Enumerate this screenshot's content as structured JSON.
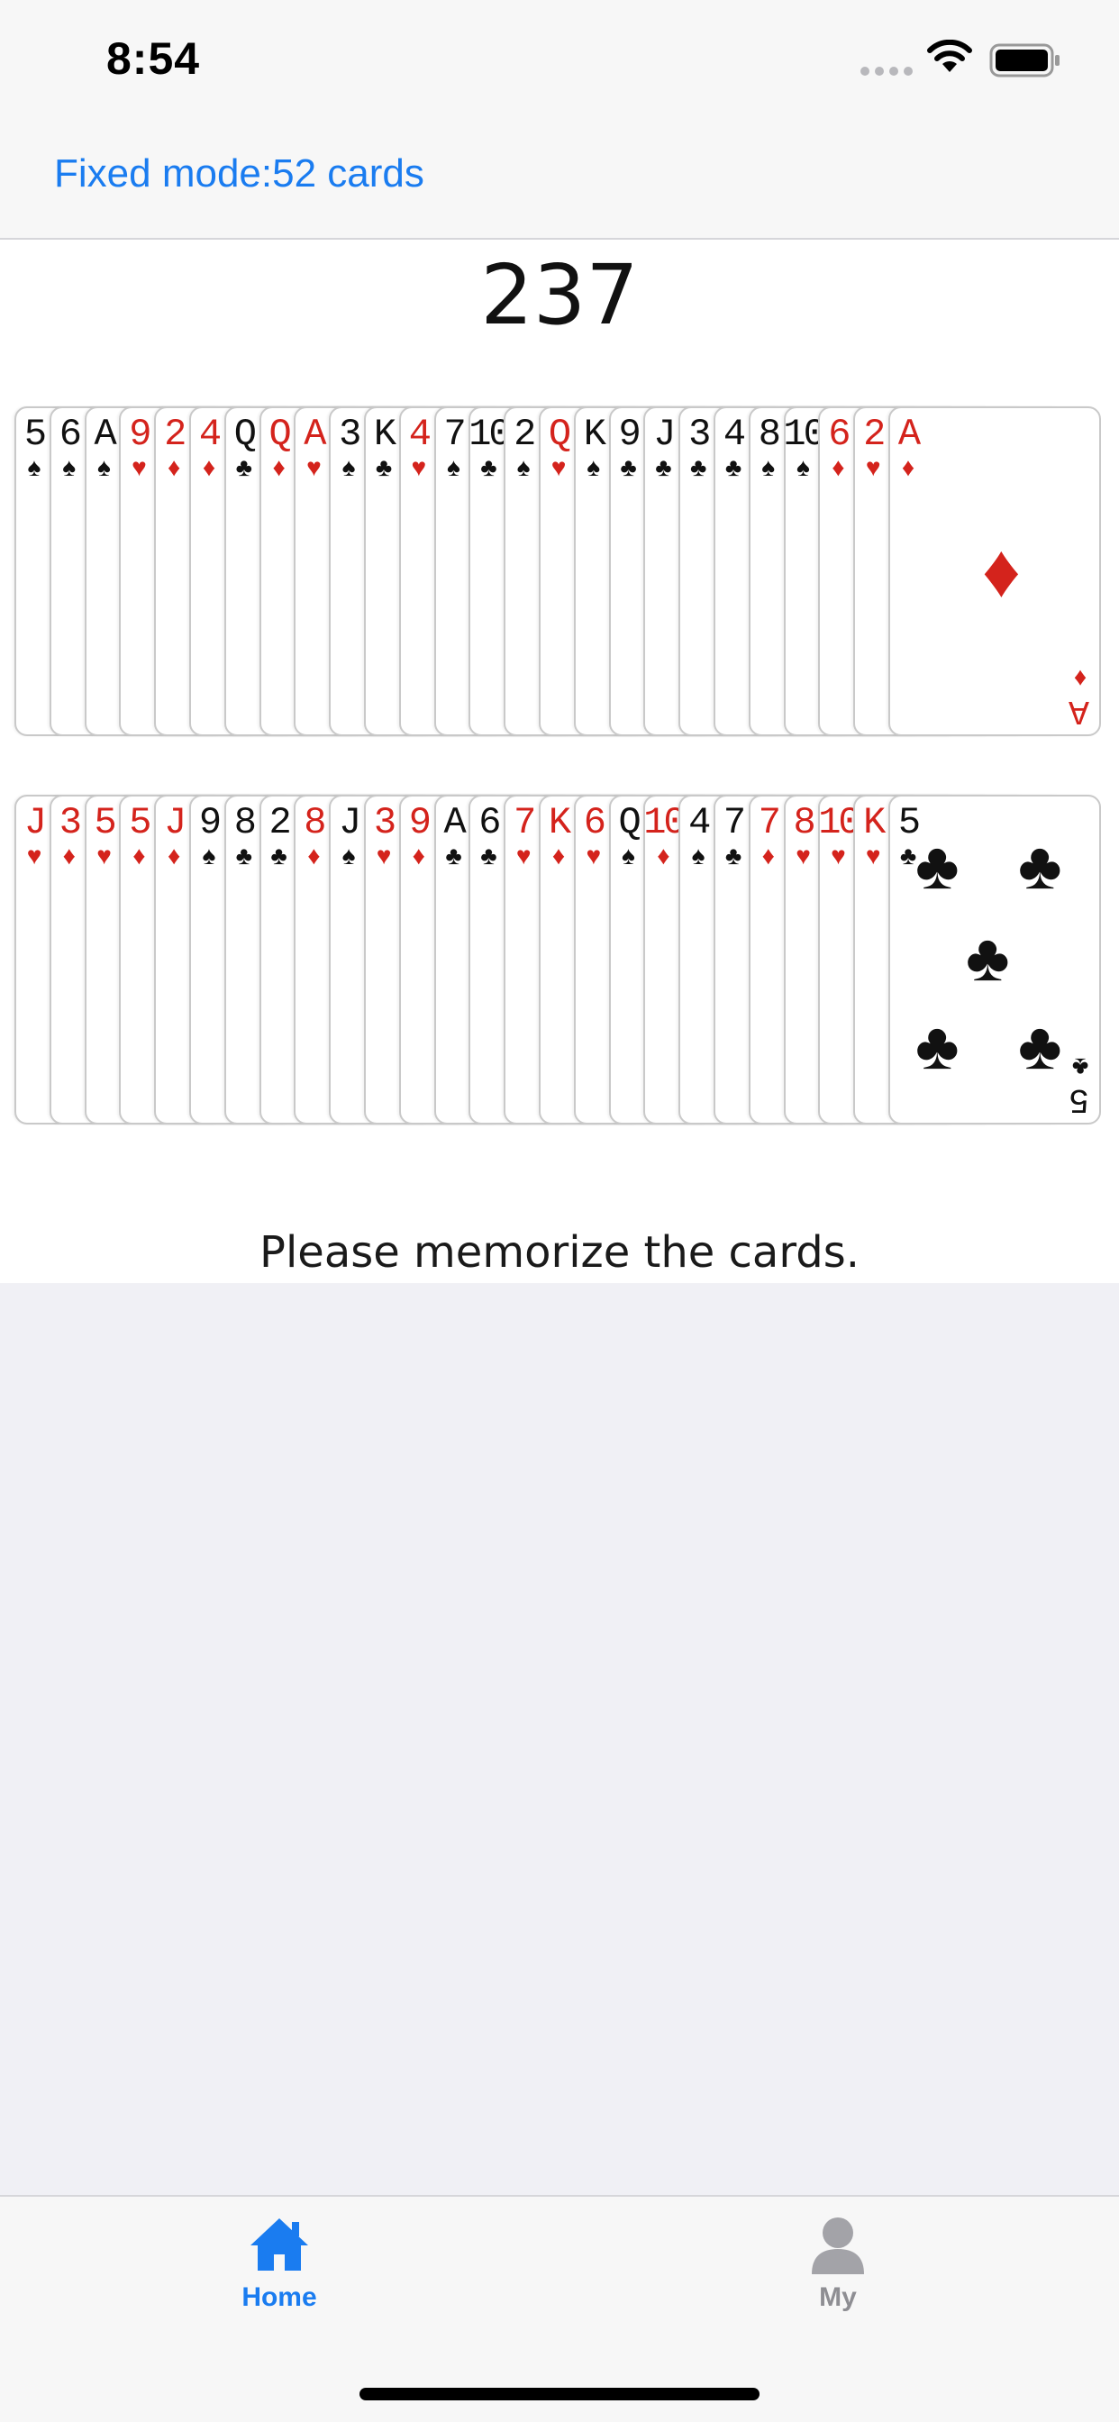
{
  "status_bar": {
    "time": "8:54"
  },
  "nav": {
    "title": "Fixed mode:52 cards"
  },
  "score": "237",
  "message": "Please memorize the cards.",
  "suit_colors": {
    "red": "#d4231c",
    "black": "#111111"
  },
  "accent_color": "#1a7cf0",
  "rows": [
    {
      "cards": [
        {
          "rank": "5",
          "suit": "♠",
          "color": "black"
        },
        {
          "rank": "6",
          "suit": "♠",
          "color": "black"
        },
        {
          "rank": "A",
          "suit": "♠",
          "color": "black"
        },
        {
          "rank": "9",
          "suit": "♥",
          "color": "red"
        },
        {
          "rank": "2",
          "suit": "♦",
          "color": "red"
        },
        {
          "rank": "4",
          "suit": "♦",
          "color": "red"
        },
        {
          "rank": "Q",
          "suit": "♣",
          "color": "black"
        },
        {
          "rank": "Q",
          "suit": "♦",
          "color": "red"
        },
        {
          "rank": "A",
          "suit": "♥",
          "color": "red"
        },
        {
          "rank": "3",
          "suit": "♠",
          "color": "black"
        },
        {
          "rank": "K",
          "suit": "♣",
          "color": "black"
        },
        {
          "rank": "4",
          "suit": "♥",
          "color": "red"
        },
        {
          "rank": "7",
          "suit": "♠",
          "color": "black"
        },
        {
          "rank": "10",
          "suit": "♣",
          "color": "black"
        },
        {
          "rank": "2",
          "suit": "♠",
          "color": "black"
        },
        {
          "rank": "Q",
          "suit": "♥",
          "color": "red"
        },
        {
          "rank": "K",
          "suit": "♠",
          "color": "black"
        },
        {
          "rank": "9",
          "suit": "♣",
          "color": "black"
        },
        {
          "rank": "J",
          "suit": "♣",
          "color": "black"
        },
        {
          "rank": "3",
          "suit": "♣",
          "color": "black"
        },
        {
          "rank": "4",
          "suit": "♣",
          "color": "black"
        },
        {
          "rank": "8",
          "suit": "♠",
          "color": "black"
        },
        {
          "rank": "10",
          "suit": "♠",
          "color": "black"
        },
        {
          "rank": "6",
          "suit": "♦",
          "color": "red"
        },
        {
          "rank": "2",
          "suit": "♥",
          "color": "red"
        },
        {
          "rank": "A",
          "suit": "♦",
          "color": "red"
        }
      ]
    },
    {
      "cards": [
        {
          "rank": "J",
          "suit": "♥",
          "color": "red"
        },
        {
          "rank": "3",
          "suit": "♦",
          "color": "red"
        },
        {
          "rank": "5",
          "suit": "♥",
          "color": "red"
        },
        {
          "rank": "5",
          "suit": "♦",
          "color": "red"
        },
        {
          "rank": "J",
          "suit": "♦",
          "color": "red"
        },
        {
          "rank": "9",
          "suit": "♠",
          "color": "black"
        },
        {
          "rank": "8",
          "suit": "♣",
          "color": "black"
        },
        {
          "rank": "2",
          "suit": "♣",
          "color": "black"
        },
        {
          "rank": "8",
          "suit": "♦",
          "color": "red"
        },
        {
          "rank": "J",
          "suit": "♠",
          "color": "black"
        },
        {
          "rank": "3",
          "suit": "♥",
          "color": "red"
        },
        {
          "rank": "9",
          "suit": "♦",
          "color": "red"
        },
        {
          "rank": "A",
          "suit": "♣",
          "color": "black"
        },
        {
          "rank": "6",
          "suit": "♣",
          "color": "black"
        },
        {
          "rank": "7",
          "suit": "♥",
          "color": "red"
        },
        {
          "rank": "K",
          "suit": "♦",
          "color": "red"
        },
        {
          "rank": "6",
          "suit": "♥",
          "color": "red"
        },
        {
          "rank": "Q",
          "suit": "♠",
          "color": "black"
        },
        {
          "rank": "10",
          "suit": "♦",
          "color": "red"
        },
        {
          "rank": "4",
          "suit": "♠",
          "color": "black"
        },
        {
          "rank": "7",
          "suit": "♣",
          "color": "black"
        },
        {
          "rank": "7",
          "suit": "♦",
          "color": "red"
        },
        {
          "rank": "8",
          "suit": "♥",
          "color": "red"
        },
        {
          "rank": "10",
          "suit": "♥",
          "color": "red"
        },
        {
          "rank": "K",
          "suit": "♥",
          "color": "red"
        },
        {
          "rank": "5",
          "suit": "♣",
          "color": "black"
        }
      ]
    }
  ],
  "tabbar": {
    "items": [
      {
        "label": "Home",
        "icon": "house-icon",
        "active": true
      },
      {
        "label": "My",
        "icon": "person-icon",
        "active": false
      }
    ]
  }
}
